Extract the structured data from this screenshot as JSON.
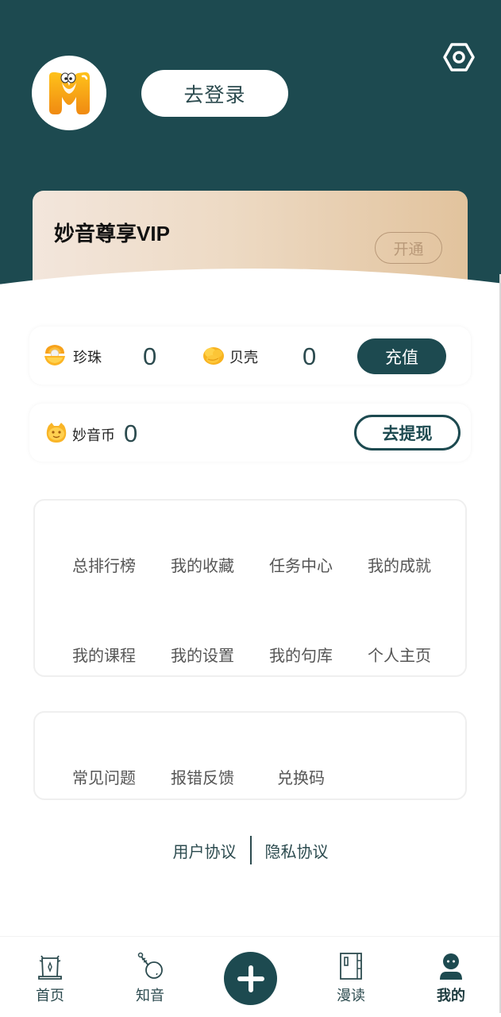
{
  "header": {
    "avatar_icon": "app-logo-m",
    "login_label": "去登录",
    "settings_icon": "settings-hex-icon"
  },
  "vip": {
    "title": "妙音尊享VIP",
    "open_label": "开通"
  },
  "wallet": {
    "pearl": {
      "label": "珍珠",
      "value": "0",
      "icon": "pearl-shell-icon"
    },
    "shell": {
      "label": "贝壳",
      "value": "0",
      "icon": "gold-shell-icon"
    },
    "recharge_label": "充值"
  },
  "coin": {
    "label": "妙音币",
    "value": "0",
    "icon": "miaoyin-coin-icon",
    "withdraw_label": "去提现"
  },
  "menu": {
    "items": [
      {
        "label": "总排行榜"
      },
      {
        "label": "我的收藏"
      },
      {
        "label": "任务中心"
      },
      {
        "label": "我的成就"
      },
      {
        "label": "我的课程"
      },
      {
        "label": "我的设置"
      },
      {
        "label": "我的句库"
      },
      {
        "label": "个人主页"
      }
    ]
  },
  "help": {
    "items": [
      {
        "label": "常见问题"
      },
      {
        "label": "报错反馈"
      },
      {
        "label": "兑换码"
      }
    ]
  },
  "footer": {
    "user_agreement": "用户协议",
    "privacy_policy": "隐私协议"
  },
  "tabbar": {
    "items": [
      {
        "label": "首页",
        "icon": "home-gate-icon"
      },
      {
        "label": "知音",
        "icon": "pipa-instrument-icon"
      },
      {
        "label": "",
        "icon": "plus-icon"
      },
      {
        "label": "漫读",
        "icon": "book-icon"
      },
      {
        "label": "我的",
        "icon": "user-icon",
        "active": true
      }
    ]
  },
  "colors": {
    "primary": "#1d4a50",
    "vip_gold": "#b89878",
    "text_dark": "#2c4b4f"
  }
}
